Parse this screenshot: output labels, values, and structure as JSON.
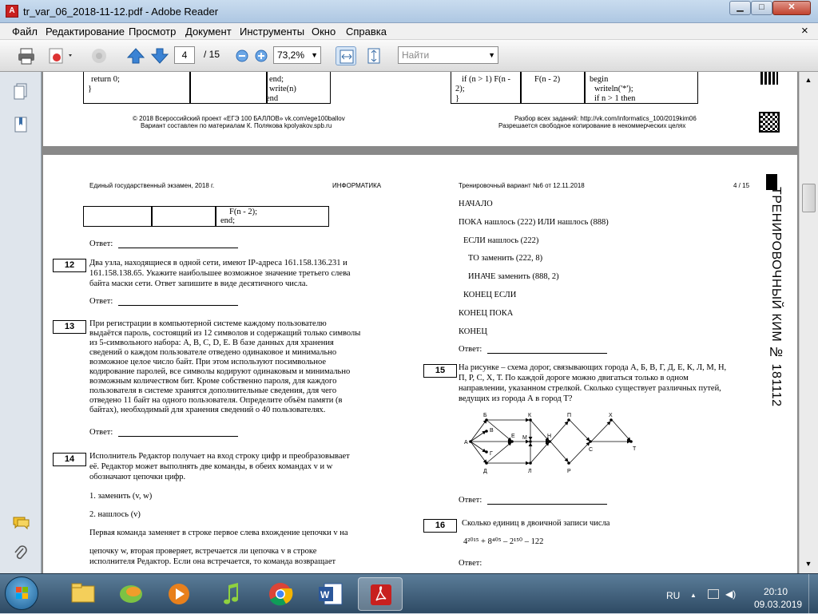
{
  "window": {
    "title": "tr_var_06_2018-11-12.pdf - Adobe Reader",
    "minimize": "▁",
    "maximize": "□",
    "close": "✕"
  },
  "menu": [
    "Файл",
    "Редактирование",
    "Просмотр",
    "Документ",
    "Инструменты",
    "Окно",
    "Справка"
  ],
  "menu_close": "×",
  "toolbar": {
    "page_current": "4",
    "page_total": "/ 15",
    "zoom": "73,2%",
    "search_placeholder": "Найти"
  },
  "page_prev": {
    "code_left": [
      "return 0;",
      "}"
    ],
    "code_left_top": "}",
    "code_mid": [
      "end;",
      "write(n)",
      "end"
    ],
    "code_right": [
      "if (n > 1) F(n -",
      "2);",
      "}"
    ],
    "code_right_mid": "F(n - 2)",
    "code_far": [
      "begin",
      "writeln('*');",
      "if n > 1 then"
    ],
    "footer_left_1": "© 2018 Всероссийский проект «ЕГЭ 100 БАЛЛОВ» vk.com/ege100ballov",
    "footer_left_2": "Вариант составлен по материалам К. Полякова kpolyakov.spb.ru",
    "footer_right_1": "Разбор всех заданий: http://vk.com/informatics_100/2019kim06",
    "footer_right_2": "Разрешается свободное копирование в некоммерческих целях"
  },
  "page4": {
    "header_left": "Единый государственный экзамен, 2018 г.",
    "header_mid": "ИНФОРМАТИКА",
    "header_right": "Тренировочный вариант №6 от 12.11.2018",
    "page_no": "4 / 15",
    "side_title": "ТРЕНИРОВОЧНЫЙ КИМ № 181112",
    "code_cont_1": "F(n - 2);",
    "code_cont_2": "end;",
    "answer_label": "Ответ: ",
    "q12_num": "12",
    "q12_lines": [
      "Два узла, находящиеся в одной сети, имеют IP-адреса 161.158.136.231 и",
      "161.158.138.65. Укажите наибольшее возможное значение третьего слева",
      "байта маски сети. Ответ запишите в виде десятичного числа."
    ],
    "q13_num": "13",
    "q13_lines": [
      " При регистрации в компьютерной системе каждому пользователю",
      "выдаётся пароль, состоящий из 12 символов и содержащий только символы",
      "из 5-символьного набора: A, B, C, D, E. В базе данных для хранения",
      "сведений о каждом пользователе отведено одинаковое и минимально",
      "возможное целое число байт. При этом используют посимвольное",
      "кодирование паролей, все символы кодируют одинаковым и минимально",
      "возможным количеством бит. Кроме собственно пароля, для каждого",
      "пользователя в системе хранятся дополнительные сведения, для чего",
      "отведено 11 байт на одного пользователя. Определите объём памяти (в",
      "байтах), необходимый для хранения сведений о 40 пользователях."
    ],
    "q14_num": "14",
    "q14_lines": [
      " Исполнитель Редактор получает на вход строку цифр и преобразовывает",
      "её. Редактор может выполнять две команды, в обеих командах v и w",
      "обозначают цепочки цифр."
    ],
    "q14_cmd1": "1. заменить (v, w)",
    "q14_cmd2": "2. нашлось (v)",
    "q14_tail": [
      "Первая команда заменяет в строке первое слева вхождение цепочки v на",
      "цепочку w, вторая проверяет, встречается ли цепочка v в строке",
      "исполнителя Редактор. Если она встречается, то команда возвращает"
    ],
    "algo": [
      "НАЧАЛО",
      "ПОКА нашлось (222) ИЛИ нашлось (888)",
      "ЕСЛИ нашлось (222)",
      "ТО заменить (222, 8)",
      "ИНАЧЕ заменить (888, 2)",
      "КОНЕЦ ЕСЛИ",
      "КОНЕЦ ПОКА",
      "КОНЕЦ"
    ],
    "q15_num": "15",
    "q15_lines": [
      "На рисунке – схема дорог, связывающих города А, Б, В, Г, Д, Е, К, Л, М, Н,",
      "П, Р, С, Х, Т. По каждой дороге можно двигаться только в одном",
      "направлении, указанном стрелкой. Сколько существует различных путей,",
      "ведущих из города А в город Т?"
    ],
    "graph_labels": [
      "А",
      "Б",
      "В",
      "Г",
      "Д",
      "Е",
      "К",
      "Л",
      "М",
      "Н",
      "П",
      "Р",
      "С",
      "Х",
      "Т"
    ],
    "q16_num": "16",
    "q16_text": "Сколько единиц в двоичной записи числа",
    "q16_expr": "4²⁰¹⁵ + 8⁴⁰⁵ – 2¹⁵⁰ – 122"
  },
  "taskbar": {
    "lang": "RU",
    "time": "20:10",
    "date": "09.03.2019"
  },
  "icons": [
    "start-icon",
    "explorer-icon",
    "media-player-icon",
    "music-icon",
    "chrome-icon",
    "word-icon",
    "adobe-reader-icon",
    "print-icon",
    "attach-icon",
    "zoom-in-icon",
    "zoom-out-icon"
  ]
}
